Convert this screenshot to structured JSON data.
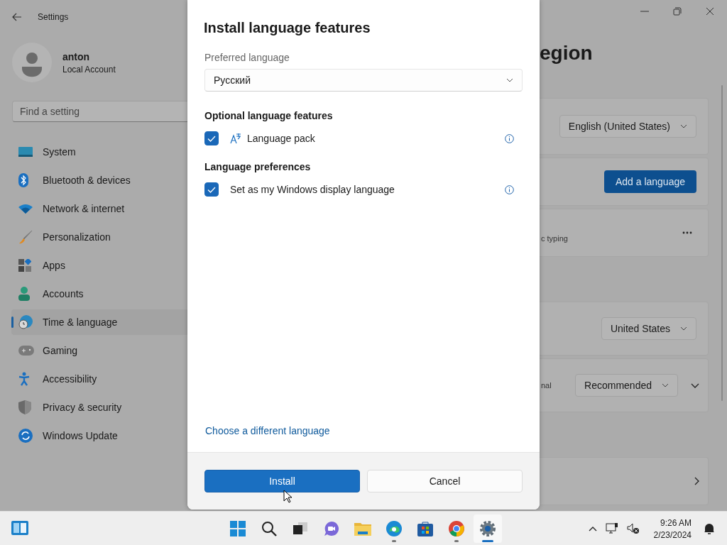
{
  "window": {
    "title": "Settings"
  },
  "account": {
    "name": "anton",
    "type": "Local Account"
  },
  "search": {
    "placeholder": "Find a setting"
  },
  "sidebar": {
    "items": [
      {
        "label": "System",
        "selected": false
      },
      {
        "label": "Bluetooth & devices",
        "selected": false
      },
      {
        "label": "Network & internet",
        "selected": false
      },
      {
        "label": "Personalization",
        "selected": false
      },
      {
        "label": "Apps",
        "selected": false
      },
      {
        "label": "Accounts",
        "selected": false
      },
      {
        "label": "Time & language",
        "selected": true
      },
      {
        "label": "Gaming",
        "selected": false
      },
      {
        "label": "Accessibility",
        "selected": false
      },
      {
        "label": "Privacy & security",
        "selected": false
      },
      {
        "label": "Windows Update",
        "selected": false
      }
    ]
  },
  "page": {
    "title": "egion",
    "sections": [
      {
        "cards": [
          {
            "kind": "dropdown",
            "value": "English (United States)"
          },
          {
            "kind": "button",
            "label": "Add a language"
          },
          {
            "kind": "more",
            "caption": "c typing"
          }
        ]
      },
      {
        "cards": [
          {
            "kind": "dropdown",
            "value": "United States"
          },
          {
            "kind": "expand",
            "caption": "nal",
            "value": "Recommended"
          }
        ]
      },
      {
        "cards": [
          {
            "kind": "link"
          }
        ]
      }
    ]
  },
  "dialog": {
    "title": "Install language features",
    "preferred_language": {
      "label": "Preferred language",
      "value": "Русский"
    },
    "groups": [
      {
        "heading": "Optional language features",
        "options": [
          {
            "label": "Language pack",
            "checked": true
          }
        ]
      },
      {
        "heading": "Language preferences",
        "options": [
          {
            "label": "Set as my Windows display language",
            "checked": true
          }
        ]
      }
    ],
    "link": "Choose a different language",
    "buttons": [
      {
        "label": "Install",
        "kind": "primary"
      },
      {
        "label": "Cancel",
        "kind": "secondary"
      }
    ]
  },
  "taskbar": {
    "apps": [
      {
        "running": false,
        "selected": false
      },
      {
        "running": false,
        "selected": false
      },
      {
        "running": false,
        "selected": false
      },
      {
        "running": false,
        "selected": false
      },
      {
        "running": false,
        "selected": false
      },
      {
        "running": true,
        "selected": false
      },
      {
        "running": false,
        "selected": false
      },
      {
        "running": true,
        "selected": false
      },
      {
        "running": true,
        "selected": true
      }
    ],
    "time": "9:26 AM",
    "date": "2/23/2024"
  }
}
